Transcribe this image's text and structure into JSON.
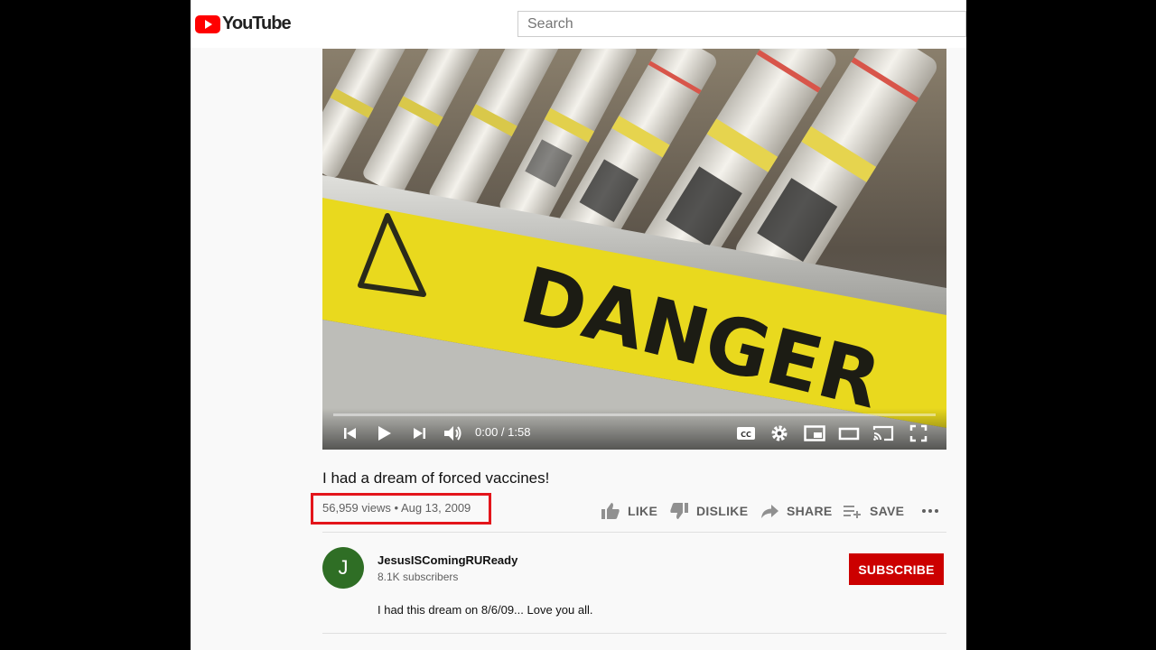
{
  "app": {
    "brand": "YouTube"
  },
  "search": {
    "placeholder": "Search"
  },
  "player": {
    "time": "0:00 / 1:58",
    "frame_text": "DANGER"
  },
  "video": {
    "title": "I had a dream of forced vaccines!",
    "views_date": "56,959 views • Aug 13, 2009"
  },
  "actions": {
    "like": "LIKE",
    "dislike": "DISLIKE",
    "share": "SHARE",
    "save": "SAVE"
  },
  "channel": {
    "avatar_letter": "J",
    "name": "JesusISComingRUReady",
    "subscribers": "8.1K subscribers",
    "subscribe_label": "SUBSCRIBE"
  },
  "description": "I had this dream on 8/6/09... Love you all.",
  "colors": {
    "brand_red": "#ff0000",
    "subscribe": "#cc0000",
    "highlight_box": "#e3151b",
    "avatar": "#2f6e25"
  }
}
